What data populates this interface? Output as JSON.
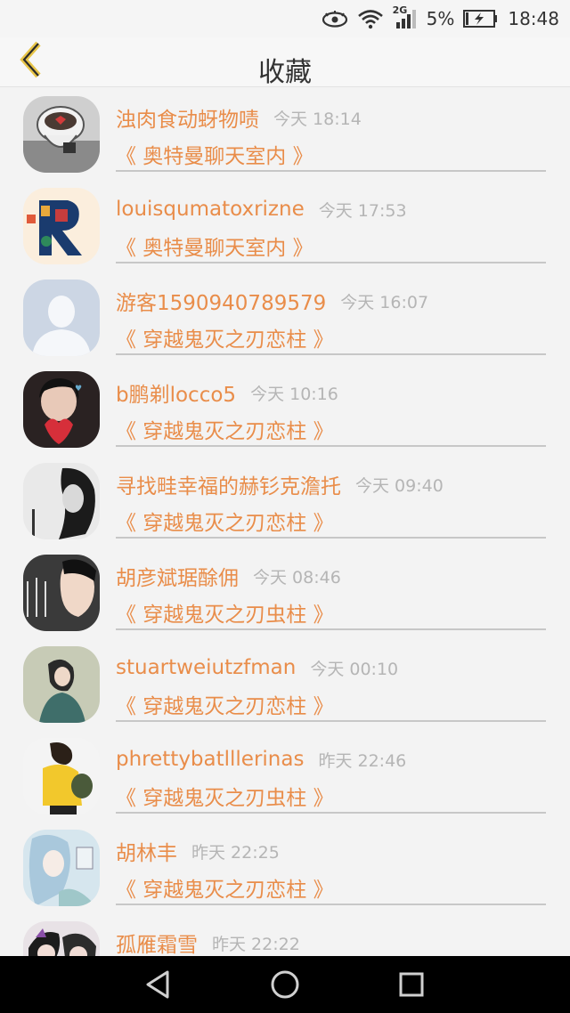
{
  "status_bar": {
    "battery_percent": "5%",
    "time": "18:48",
    "network": "2G",
    "icons": [
      "eye-icon",
      "wifi-icon",
      "signal-icon",
      "battery-charging-icon"
    ]
  },
  "header": {
    "title": "收藏",
    "back_icon": "chevron-left-icon",
    "accent_color": "#e8c548"
  },
  "colors": {
    "name_color": "#e98d4a",
    "time_color": "#b5b5b5"
  },
  "favorites": [
    {
      "name": "浊肉食动蚜物啧",
      "time": "今天 18:14",
      "room": "《 奥特曼聊天室内 》"
    },
    {
      "name": "louisqumatoxrizne",
      "time": "今天 17:53",
      "room": "《 奥特曼聊天室内 》"
    },
    {
      "name": "游客1590940789579",
      "time": "今天 16:07",
      "room": "《 穿越鬼灭之刃恋柱 》"
    },
    {
      "name": "b鹏剃locco5",
      "time": "今天 10:16",
      "room": "《 穿越鬼灭之刃恋柱 》"
    },
    {
      "name": "寻找畦幸福的赫钐克澹托",
      "time": "今天 09:40",
      "room": "《 穿越鬼灭之刃恋柱 》"
    },
    {
      "name": "胡彦斌琚酴佣",
      "time": "今天 08:46",
      "room": "《 穿越鬼灭之刃虫柱 》"
    },
    {
      "name": "stuartweiutzfman",
      "time": "今天 00:10",
      "room": "《 穿越鬼灭之刃恋柱 》"
    },
    {
      "name": "phrettybatlllerinas",
      "time": "昨天 22:46",
      "room": "《 穿越鬼灭之刃虫柱 》"
    },
    {
      "name": "胡林丰",
      "time": "昨天 22:25",
      "room": "《 穿越鬼灭之刃恋柱 》"
    },
    {
      "name": "孤雁霜雪",
      "time": "昨天 22:22",
      "room": ""
    }
  ],
  "nav_bar": {
    "buttons": [
      "back-triangle-icon",
      "home-circle-icon",
      "recents-square-icon"
    ]
  }
}
